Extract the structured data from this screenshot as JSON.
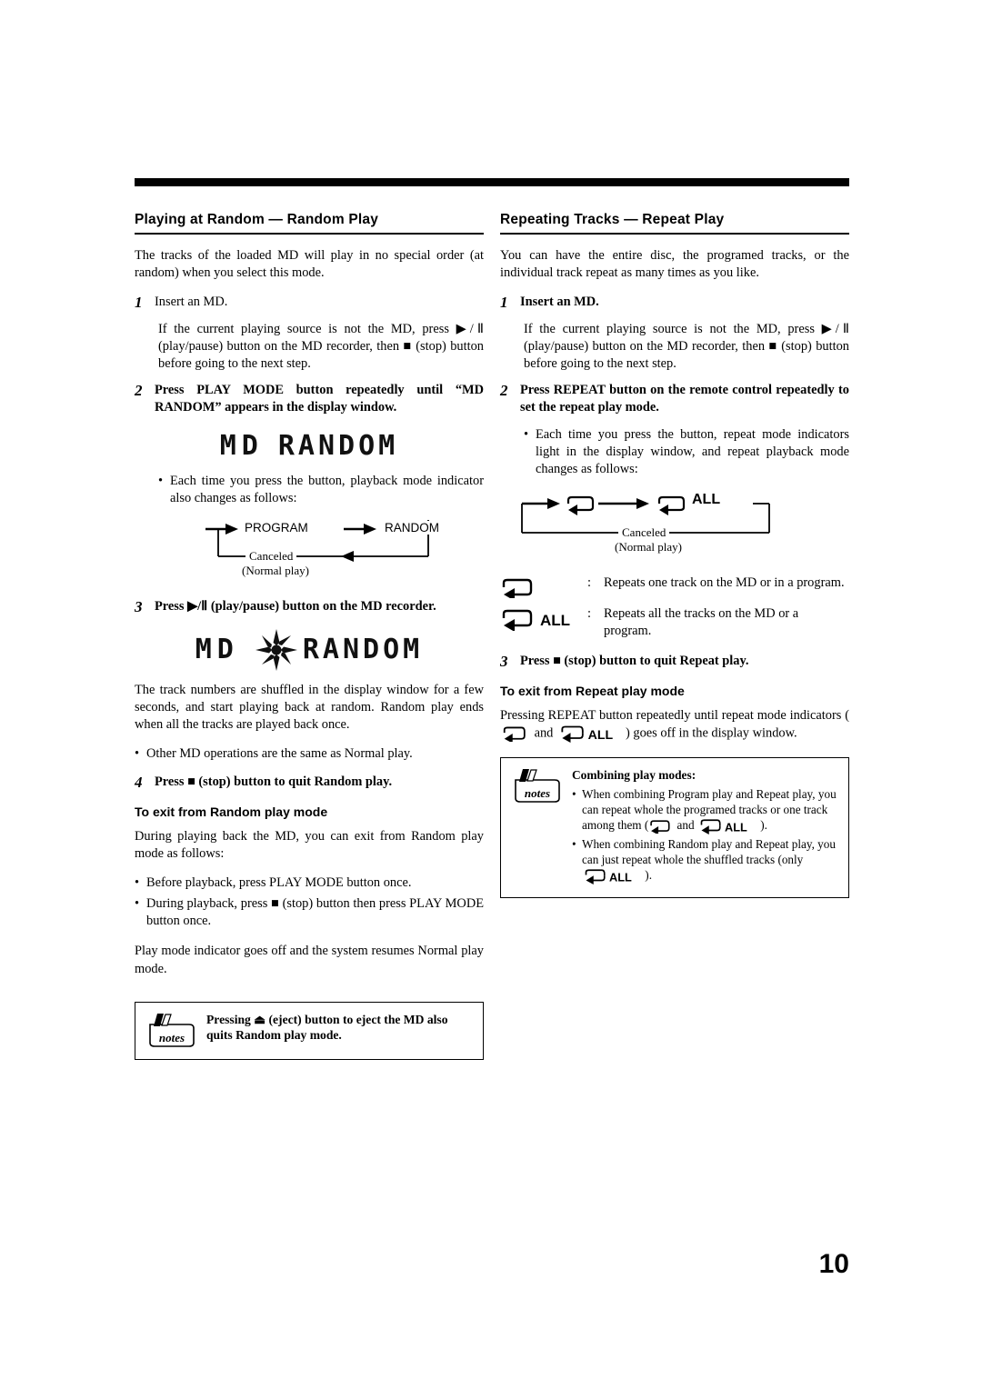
{
  "page": {
    "number": "10"
  },
  "left": {
    "title": "Playing at Random — Random Play",
    "intro": "The tracks of the loaded MD will play in no special order (at random) when you select this mode.",
    "steps": [
      {
        "num": "1",
        "head": "Insert an MD.",
        "detail": "If the current playing source is not the MD, press ▶/Ⅱ (play/pause) button on the MD recorder, then ■ (stop) button before going to the next step."
      },
      {
        "num": "2",
        "head": "Press PLAY MODE button repeatedly until “MD RANDOM” appears in the display window."
      },
      {
        "num": "3",
        "head": "Press ▶/Ⅱ (play/pause) button on the MD recorder."
      },
      {
        "num": "4",
        "head": "Press ■ (stop) button to quit Random play."
      }
    ],
    "lcd1": {
      "md": "MD",
      "mode": "RANDOM"
    },
    "bullet_after_step2": "Each time you press the button, playback mode indicator also changes as follows:",
    "flow": {
      "left_label": "PROGRAM",
      "right_label": "RANDOM",
      "canceled": "Canceled",
      "normal": "(Normal play)"
    },
    "lcd2": {
      "md": "MD",
      "mode": "RANDOM"
    },
    "after_step3": "The track numbers are shuffled in the display window for a few seconds, and start playing back at random. Random play ends when all the tracks are played back once.",
    "bullet_other_ops": "Other MD operations are the same as Normal play.",
    "exit_title": "To exit from Random play mode",
    "exit_intro": "During playing back the MD, you can exit from Random play mode as follows:",
    "exit_bullets": [
      "Before playback, press PLAY MODE button once.",
      "During playback, press ■ (stop) button then press PLAY MODE button once."
    ],
    "exit_close": "Play mode indicator goes off and the system resumes Normal play mode.",
    "note": "Pressing ⏏ (eject) button to eject the MD also quits Random play mode.",
    "notes_badge_label": "notes"
  },
  "right": {
    "title": "Repeating Tracks — Repeat Play",
    "intro": "You can have the entire disc, the programed tracks, or the individual track repeat as many times as you like.",
    "steps": [
      {
        "num": "1",
        "head": "Insert an MD.",
        "detail": "If the current playing source is not the MD, press ▶/Ⅱ (play/pause) button on the MD recorder, then ■ (stop) button before going to the next step."
      },
      {
        "num": "2",
        "head": "Press REPEAT button on the remote control repeatedly to set the repeat play mode."
      },
      {
        "num": "3",
        "head": "Press ■ (stop) button to quit Repeat play."
      }
    ],
    "bullet_after_step2": "Each time you press the button, repeat mode indicators light in the display window, and repeat playback mode changes as follows:",
    "flow": {
      "canceled": "Canceled",
      "normal": "(Normal play)",
      "all_label": "ALL"
    },
    "repeat_defs": [
      {
        "icon": "repeat-one",
        "text": "Repeats one track on the MD or in a program."
      },
      {
        "icon": "repeat-all",
        "text": "Repeats all the tracks on the MD or a program."
      }
    ],
    "exit_title": "To exit from Repeat play mode",
    "exit_text_a": "Pressing REPEAT button repeatedly until repeat mode indicators (",
    "exit_text_b": " and ",
    "exit_text_c": ") goes off in the display window.",
    "notes": {
      "title": "Combining play modes:",
      "badge_label": "notes",
      "bullets": [
        {
          "a": "When combining Program play and Repeat play, you can repeat whole the programed tracks or one track among them (",
          "b": " and ",
          "c": " )."
        },
        {
          "a": "When combining Random play and Repeat play, you can just repeat whole the shuffled tracks (only ",
          "b": "",
          "c": " )."
        }
      ]
    },
    "all_label": "ALL"
  }
}
